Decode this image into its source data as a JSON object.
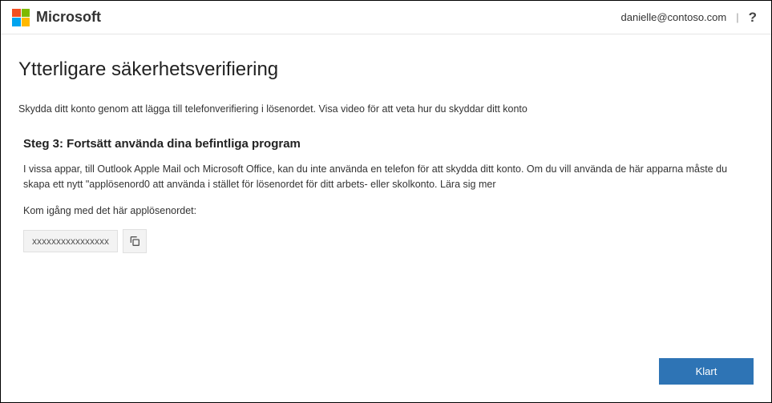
{
  "header": {
    "brand": "Microsoft",
    "user_email": "danielle@contoso.com",
    "divider": "|",
    "help": "?"
  },
  "page": {
    "title": "Ytterligare säkerhetsverifiering",
    "description": "Skydda ditt konto genom att lägga till telefonverifiering i lösenordet. Visa video för att veta hur du skyddar ditt konto"
  },
  "step": {
    "heading": "Steg 3: Fortsätt använda dina befintliga program",
    "body": "I vissa appar, till Outlook Apple Mail och Microsoft Office, kan du inte använda en telefon för att skydda ditt konto. Om du vill använda de här apparna måste du skapa ett nytt \"applösenord0 att använda i stället för lösenordet för ditt arbets- eller skolkonto. Lära sig mer",
    "get_started": "Kom igång med det här applösenordet:",
    "password_value": "xxxxxxxxxxxxxxxx"
  },
  "actions": {
    "done": "Klart"
  }
}
